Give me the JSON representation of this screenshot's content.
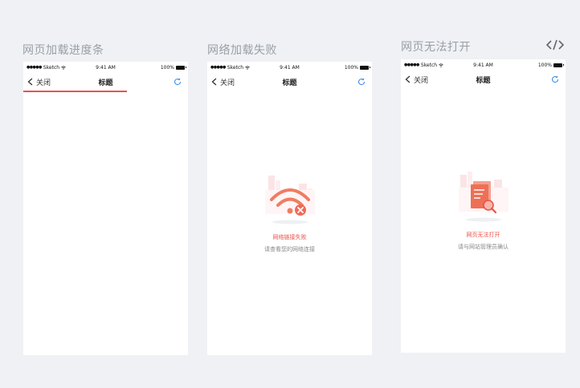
{
  "screens": [
    {
      "label": "网页加载进度条",
      "status": {
        "carrier": "Sketch",
        "time": "9:41 AM",
        "battery": "100%"
      },
      "nav": {
        "back_label": "关闭",
        "title": "标题"
      },
      "progress_fraction": 0.63
    },
    {
      "label": "网络加载失败",
      "status": {
        "carrier": "Sketch",
        "time": "9:41 AM",
        "battery": "100%"
      },
      "nav": {
        "back_label": "关闭",
        "title": "标题"
      },
      "error": {
        "title": "网络链接失败",
        "subtitle": "请查看您的网络连接"
      }
    },
    {
      "label": "网页无法打开",
      "status": {
        "carrier": "Sketch",
        "time": "9:41 AM",
        "battery": "100%"
      },
      "nav": {
        "back_label": "关闭",
        "title": "标题"
      },
      "error": {
        "title": "网页无法打开",
        "subtitle": "请与网站管理员确认"
      }
    }
  ],
  "colors": {
    "accent": "#e8534a",
    "refresh": "#3a8ee6",
    "background": "#eff1f4"
  },
  "icons": {
    "code_toggle": "code-icon",
    "refresh": "refresh-icon",
    "back": "chevron-left-icon"
  }
}
